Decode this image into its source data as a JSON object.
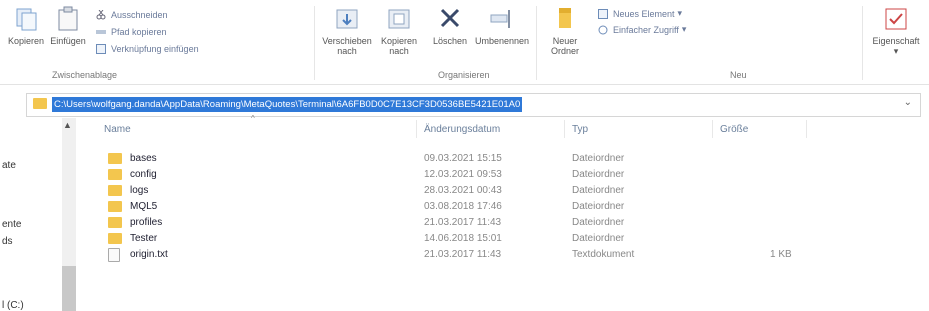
{
  "ribbon": {
    "clipboard": {
      "copy_label": "Kopieren",
      "paste_label": "Einfügen",
      "cut_label": "Ausschneiden",
      "copy_path_label": "Pfad kopieren",
      "paste_shortcut_label": "Verknüpfung einfügen",
      "group_label": "Zwischenablage"
    },
    "organize": {
      "move_to_label": "Verschieben nach",
      "copy_to_label": "Kopieren nach",
      "delete_label": "Löschen",
      "rename_label": "Umbenennen",
      "group_label": "Organisieren"
    },
    "new": {
      "new_folder_label": "Neuer Ordner",
      "new_item_label": "Neues Element",
      "easy_access_label": "Einfacher Zugriff",
      "group_label": "Neu"
    },
    "open": {
      "properties_label": "Eigenschaft"
    }
  },
  "address_bar": {
    "path": "C:\\Users\\wolfgang.danda\\AppData\\Roaming\\MetaQuotes\\Terminal\\6A6FB0D0C7E13CF3D0536BE5421E01A0"
  },
  "nav_pane": {
    "items": [
      "ate",
      "ente",
      "ds",
      "l (C:)"
    ]
  },
  "table": {
    "headers": {
      "name": "Name",
      "date": "Änderungsdatum",
      "type": "Typ",
      "size": "Größe"
    },
    "rows": [
      {
        "name": "bases",
        "date": "09.03.2021 15:15",
        "type": "Dateiordner",
        "size": "",
        "kind": "folder"
      },
      {
        "name": "config",
        "date": "12.03.2021 09:53",
        "type": "Dateiordner",
        "size": "",
        "kind": "folder"
      },
      {
        "name": "logs",
        "date": "28.03.2021 00:43",
        "type": "Dateiordner",
        "size": "",
        "kind": "folder"
      },
      {
        "name": "MQL5",
        "date": "03.08.2018 17:46",
        "type": "Dateiordner",
        "size": "",
        "kind": "folder"
      },
      {
        "name": "profiles",
        "date": "21.03.2017 11:43",
        "type": "Dateiordner",
        "size": "",
        "kind": "folder"
      },
      {
        "name": "Tester",
        "date": "14.06.2018 15:01",
        "type": "Dateiordner",
        "size": "",
        "kind": "folder"
      },
      {
        "name": "origin.txt",
        "date": "21.03.2017 11:43",
        "type": "Textdokument",
        "size": "1 KB",
        "kind": "file"
      }
    ]
  },
  "colors": {
    "selection": "#2f79d8",
    "folder": "#f3c64e",
    "delete_red": "#3a4a6a",
    "accent": "#2f79d8"
  }
}
